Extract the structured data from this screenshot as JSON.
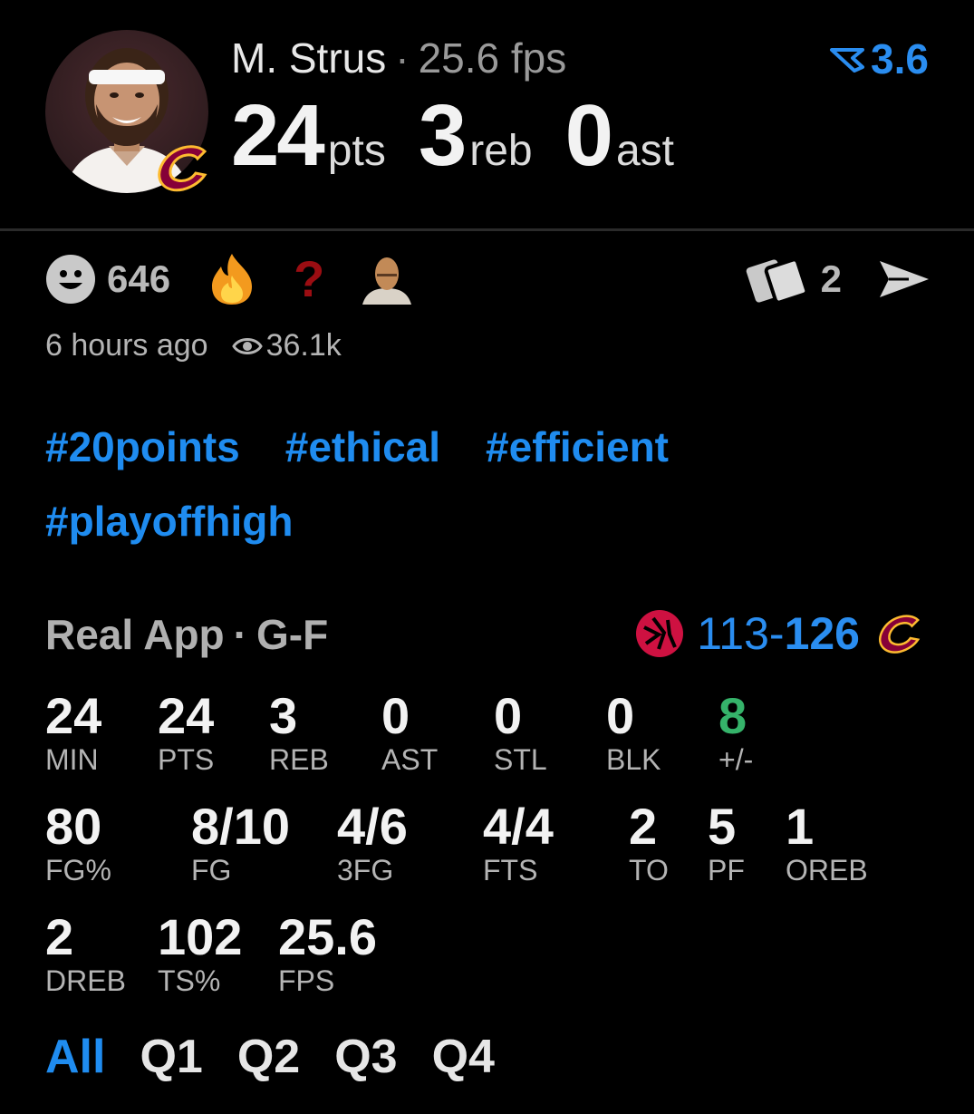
{
  "player": {
    "name": "M. Strus",
    "fps": "25.6 fps",
    "rank_value": "3.6",
    "headline": [
      {
        "value": "24",
        "unit": "pts"
      },
      {
        "value": "3",
        "unit": "reb"
      },
      {
        "value": "0",
        "unit": "ast"
      }
    ]
  },
  "reactions": {
    "count": "646",
    "icons": [
      "smiley-icon",
      "fire-icon",
      "question-mark-icon",
      "meme-face-icon"
    ]
  },
  "share": {
    "reposts": "2"
  },
  "meta": {
    "time_ago": "6 hours ago",
    "views": "36.1k"
  },
  "hashtags": [
    "#20points",
    "#ethical",
    "#efficient",
    "#playoffhigh"
  ],
  "game": {
    "source": "Real App",
    "position": "G-F",
    "score_lose": "113",
    "score_sep": "-",
    "score_win": "126",
    "colors": {
      "accent": "#1f8cf0",
      "raptors": "#ce1141",
      "cavs": "#860038"
    }
  },
  "stats": {
    "row1": [
      {
        "v": "24",
        "l": "MIN"
      },
      {
        "v": "24",
        "l": "PTS"
      },
      {
        "v": "3",
        "l": "REB"
      },
      {
        "v": "0",
        "l": "AST"
      },
      {
        "v": "0",
        "l": "STL"
      },
      {
        "v": "0",
        "l": "BLK"
      },
      {
        "v": "8",
        "l": "+/-"
      }
    ],
    "row2": [
      {
        "v": "80",
        "l": "FG%"
      },
      {
        "v": "8/10",
        "l": "FG"
      },
      {
        "v": "4/6",
        "l": "3FG"
      },
      {
        "v": "4/4",
        "l": "FTS"
      },
      {
        "v": "2",
        "l": "TO"
      },
      {
        "v": "5",
        "l": "PF"
      },
      {
        "v": "1",
        "l": "OREB"
      }
    ],
    "row3": [
      {
        "v": "2",
        "l": "DREB"
      },
      {
        "v": "102",
        "l": "TS%"
      },
      {
        "v": "25.6",
        "l": "FPS"
      }
    ]
  },
  "tabs": [
    "All",
    "Q1",
    "Q2",
    "Q3",
    "Q4"
  ]
}
